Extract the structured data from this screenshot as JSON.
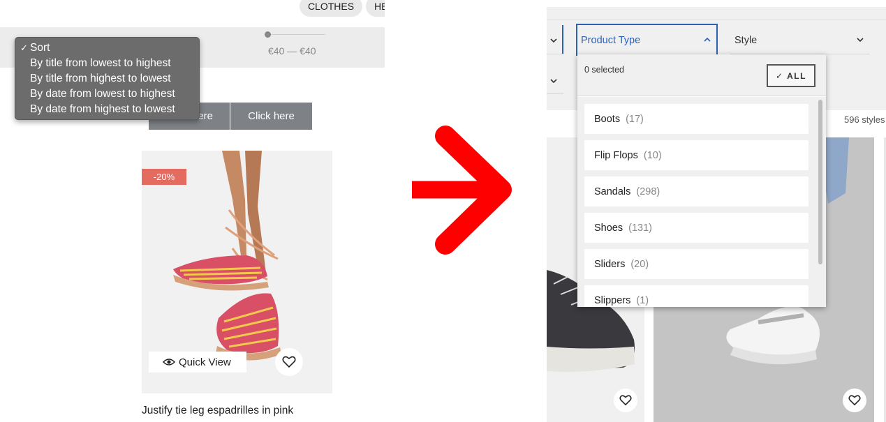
{
  "left_screen": {
    "nav_pills": [
      "CLOTHES",
      "HE"
    ],
    "price_filter": {
      "range_label": "€40 — €40"
    },
    "sort_menu": {
      "items": [
        {
          "label": "Sort",
          "checked": true
        },
        {
          "label": "By title from lowest to highest",
          "checked": false
        },
        {
          "label": "By title from highest to lowest",
          "checked": false
        },
        {
          "label": "By date from lowest to highest",
          "checked": false
        },
        {
          "label": "By date from highest to lowest",
          "checked": false
        }
      ],
      "check_glyph": "✓"
    },
    "buttons": {
      "first_label_visible": "ere",
      "second_label": "Click here"
    },
    "product": {
      "discount_badge": "-20%",
      "quick_view_label": "Quick View",
      "name": "Justify tie leg espadrilles in pink"
    }
  },
  "arrow": {
    "color": "#ff0000"
  },
  "right_screen": {
    "product_type_filter": {
      "label": "Product Type",
      "expanded": true
    },
    "style_filter": {
      "label": "Style"
    },
    "styles_count": "596 styles",
    "dropdown": {
      "selected_text": "0 selected",
      "all_button_label": "ALL",
      "options": [
        {
          "name": "Boots",
          "count": "(17)"
        },
        {
          "name": "Flip Flops",
          "count": "(10)"
        },
        {
          "name": "Sandals",
          "count": "(298)"
        },
        {
          "name": "Shoes",
          "count": "(131)"
        },
        {
          "name": "Sliders",
          "count": "(20)"
        },
        {
          "name": "Slippers",
          "count": "(1)"
        }
      ]
    }
  },
  "colors": {
    "accent_blue": "#2d5fb3",
    "discount_red": "#e36b5f",
    "menu_grey": "#6c6c6c",
    "button_grey": "#7e8287"
  }
}
